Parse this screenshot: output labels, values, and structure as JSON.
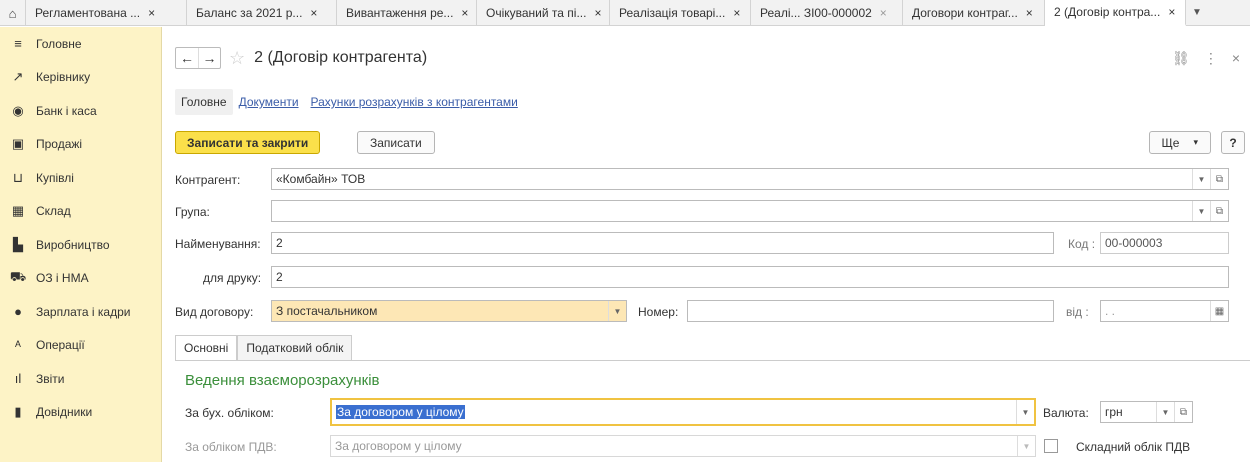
{
  "tabs": [
    {
      "label": "Регламентована ...",
      "close": "×"
    },
    {
      "label": "Баланс за 2021 р...",
      "close": "×"
    },
    {
      "label": "Вивантаження ре...",
      "close": "×"
    },
    {
      "label": "Очікуваний та пі...",
      "close": "×"
    },
    {
      "label": "Реалізація товарі...",
      "close": "×"
    },
    {
      "label": "Реалі... ЗІ00-000002",
      "close": "×"
    },
    {
      "label": "Договори контраг...",
      "close": "×"
    },
    {
      "label": "2 (Договір контра...",
      "close": "×"
    }
  ],
  "sidebar": {
    "items": [
      {
        "label": "Головне",
        "icon": "≡"
      },
      {
        "label": "Керівнику",
        "icon": "↗"
      },
      {
        "label": "Банк і каса",
        "icon": "◉"
      },
      {
        "label": "Продажі",
        "icon": "▣"
      },
      {
        "label": "Купівлі",
        "icon": "⊔"
      },
      {
        "label": "Склад",
        "icon": "▦"
      },
      {
        "label": "Виробництво",
        "icon": "▙"
      },
      {
        "label": "ОЗ і НМА",
        "icon": "⛟"
      },
      {
        "label": "Зарплата і кадри",
        "icon": "●"
      },
      {
        "label": "Операції",
        "icon": "ᴬ"
      },
      {
        "label": "Звіти",
        "icon": "ıl"
      },
      {
        "label": "Довідники",
        "icon": "▮"
      }
    ]
  },
  "header": {
    "title": "2 (Договір контрагента)",
    "back": "←",
    "forward": "→",
    "star": "☆",
    "link_icon": "⛓",
    "menu_icon": "⋮",
    "close_icon": "×"
  },
  "sections": {
    "main": "Головне",
    "documents": "Документи",
    "accounts": "Рахунки розрахунків з контрагентами"
  },
  "toolbar": {
    "save_close": "Записати та закрити",
    "save": "Записати",
    "more": "Ще",
    "more_arrow": "▾",
    "help": "?"
  },
  "form": {
    "counterparty_label": "Контрагент:",
    "counterparty_value": "«Комбайн» ТОВ",
    "group_label": "Група:",
    "group_value": "",
    "name_label": "Найменування:",
    "name_value": "2",
    "code_label": "Код :",
    "code_value": "00-000003",
    "print_label": "для друку:",
    "print_value": "2",
    "type_label": "Вид договору:",
    "type_value": "З постачальником",
    "number_label": "Номер:",
    "number_value": "",
    "date_label": "від  :",
    "date_value": " .  ."
  },
  "inner_tabs": {
    "main": "Основні",
    "tax": "Податковий облік"
  },
  "settlements": {
    "title": "Ведення взаєморозрахунків",
    "acc_label": "За бух. обліком:",
    "acc_value": "За договором у цілому",
    "vat_label": "За обліком ПДВ:",
    "vat_value": "За договором у цілому",
    "currency_label": "Валюта:",
    "currency_value": "грн",
    "complex_vat_label": "Складний облік ПДВ"
  },
  "colors": {
    "sidebar_bg": "#fdf3c6",
    "primary_button": "#fbe04a",
    "section_title": "#3b8f3b",
    "link": "#3a5ca8"
  }
}
